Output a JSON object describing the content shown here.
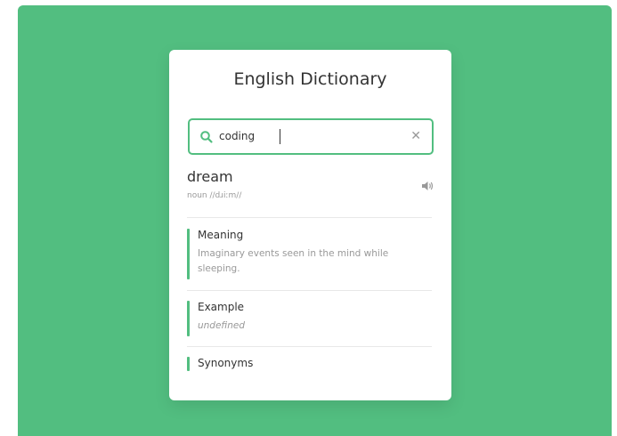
{
  "app": {
    "title": "English Dictionary"
  },
  "search": {
    "value": "coding"
  },
  "result": {
    "word": "dream",
    "phonetic": "noun //dɹiːm//"
  },
  "meaning": {
    "label": "Meaning",
    "text": "Imaginary events seen in the mind while sleeping."
  },
  "example": {
    "label": "Example",
    "text": "undefined"
  },
  "synonyms": {
    "label": "Synonyms"
  },
  "icons": {
    "search": "search-icon",
    "clear": "close-icon",
    "audio": "volume-icon"
  },
  "colors": {
    "accent": "#52be80",
    "background": "#52be80"
  }
}
